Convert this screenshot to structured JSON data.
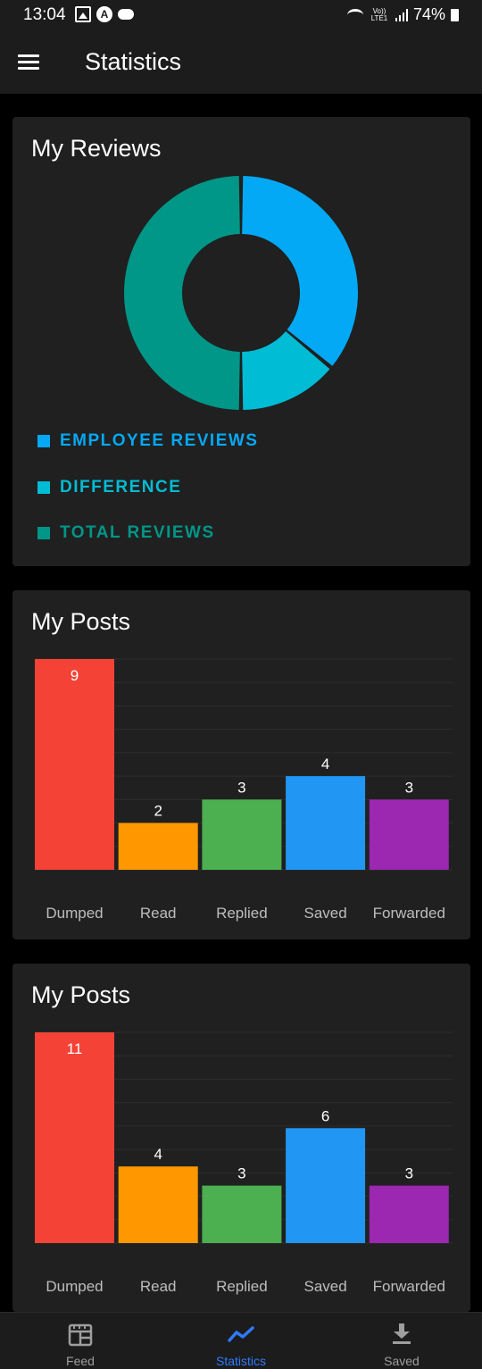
{
  "status_bar": {
    "time": "13:04",
    "volte_text": "Vo)) LTE1",
    "battery": "74%"
  },
  "app_bar": {
    "title": "Statistics"
  },
  "reviews_card": {
    "title": "My Reviews",
    "legend": [
      {
        "label": "EMPLOYEE REVIEWS",
        "color": "#03a9f4"
      },
      {
        "label": "DIFFERENCE",
        "color": "#00bcd4"
      },
      {
        "label": "TOTAL REVIEWS",
        "color": "#009688"
      }
    ]
  },
  "posts_card_1": {
    "title": "My Posts"
  },
  "posts_card_2": {
    "title": "My Posts"
  },
  "chart_data": [
    {
      "type": "pie",
      "title": "My Reviews",
      "labels": [
        "EMPLOYEE REVIEWS",
        "DIFFERENCE",
        "TOTAL REVIEWS"
      ],
      "values": [
        36,
        14,
        50
      ],
      "colors": [
        "#03a9f4",
        "#00bcd4",
        "#009688"
      ],
      "donut": true,
      "legend": "bottom-left"
    },
    {
      "type": "bar",
      "title": "My Posts",
      "categories": [
        "Dumped",
        "Read",
        "Replied",
        "Saved",
        "Forwarded"
      ],
      "values": [
        9,
        2,
        3,
        4,
        3
      ],
      "colors": [
        "#f44336",
        "#ff9800",
        "#4caf50",
        "#2196f3",
        "#9c27b0"
      ],
      "ylim": [
        0,
        9
      ],
      "grid": true
    },
    {
      "type": "bar",
      "title": "My Posts",
      "categories": [
        "Dumped",
        "Read",
        "Replied",
        "Saved",
        "Forwarded"
      ],
      "values": [
        11,
        4,
        3,
        6,
        3
      ],
      "colors": [
        "#f44336",
        "#ff9800",
        "#4caf50",
        "#2196f3",
        "#9c27b0"
      ],
      "ylim": [
        0,
        11
      ],
      "grid": true
    }
  ],
  "bottom_nav": {
    "items": [
      {
        "label": "Feed",
        "icon": "feed-icon",
        "active": false
      },
      {
        "label": "Statistics",
        "icon": "statistics-icon",
        "active": true
      },
      {
        "label": "Saved",
        "icon": "download-icon",
        "active": false
      }
    ],
    "active_color": "#2f7bff",
    "inactive_color": "#9e9e9e"
  }
}
